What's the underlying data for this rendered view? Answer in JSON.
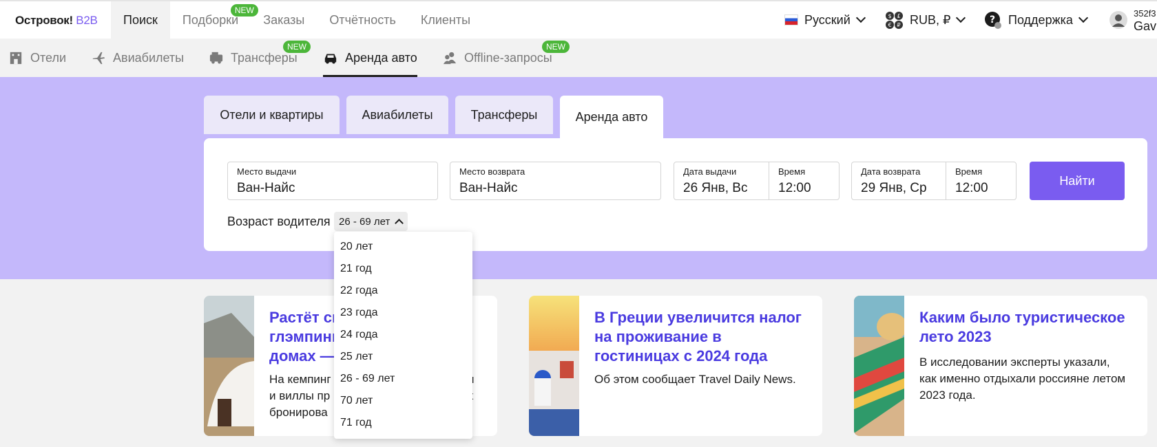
{
  "logo": {
    "text": "Островок!",
    "b2b": "B2B"
  },
  "top_nav": {
    "items": [
      {
        "label": "Поиск"
      },
      {
        "label": "Подборки",
        "badge": "NEW"
      },
      {
        "label": "Заказы"
      },
      {
        "label": "Отчётность"
      },
      {
        "label": "Клиенты"
      }
    ]
  },
  "top_right": {
    "language": "Русский",
    "currency": "RUB, ₽",
    "support": "Поддержка",
    "user_line1": "352f3",
    "user_line2": "Gav"
  },
  "sub_nav": {
    "items": [
      {
        "label": "Отели",
        "icon": "hotel-icon"
      },
      {
        "label": "Авиабилеты",
        "icon": "plane-icon"
      },
      {
        "label": "Трансферы",
        "icon": "bus-icon",
        "badge": "NEW"
      },
      {
        "label": "Аренда авто",
        "icon": "car-icon"
      },
      {
        "label": "Offline-запросы",
        "icon": "users-icon",
        "badge": "NEW"
      }
    ]
  },
  "search_tabs": [
    {
      "label": "Отели и квартиры"
    },
    {
      "label": "Авиабилеты"
    },
    {
      "label": "Трансферы"
    },
    {
      "label": "Аренда авто"
    }
  ],
  "form": {
    "pickup_label": "Место выдачи",
    "pickup_value": "Ван-Найс",
    "return_label": "Место возврата",
    "return_value": "Ван-Найс",
    "pickup_date_label": "Дата выдачи",
    "pickup_date_value": "26 Янв, Вс",
    "pickup_time_label": "Время",
    "pickup_time_value": "12:00",
    "return_date_label": "Дата возврата",
    "return_date_value": "29 Янв, Ср",
    "return_time_label": "Время",
    "return_time_value": "12:00",
    "find_button": "Найти",
    "driver_age_label": "Возраст водителя",
    "driver_age_value": "26 - 69 лет"
  },
  "age_options": [
    "20 лет",
    "21 год",
    "22 года",
    "23 года",
    "24 года",
    "25 лет",
    "26 - 69 лет",
    "70 лет",
    "71 год"
  ],
  "news": [
    {
      "title_lines": [
        "Растёт сп",
        "глэмпинг",
        "домах —"
      ],
      "desc_lines": [
        "На кемпинг",
        "и виллы пр",
        "бронирова"
      ],
      "desc_tail": [
        "и",
        "х",
        ""
      ]
    },
    {
      "title": "В Греции увеличится налог на проживание в гостиницах с 2024 года",
      "desc": "Об этом сообщает Travel Daily News."
    },
    {
      "title": "Каким было туристическое лето 2023",
      "desc": "В исследовании эксперты указали, как именно отдыхали россияне летом 2023 года."
    }
  ],
  "colors": {
    "accent": "#7a5cf0",
    "hero_bg": "#c4b8fb",
    "badge": "#4cb63a",
    "news_title": "#4a3be0"
  }
}
